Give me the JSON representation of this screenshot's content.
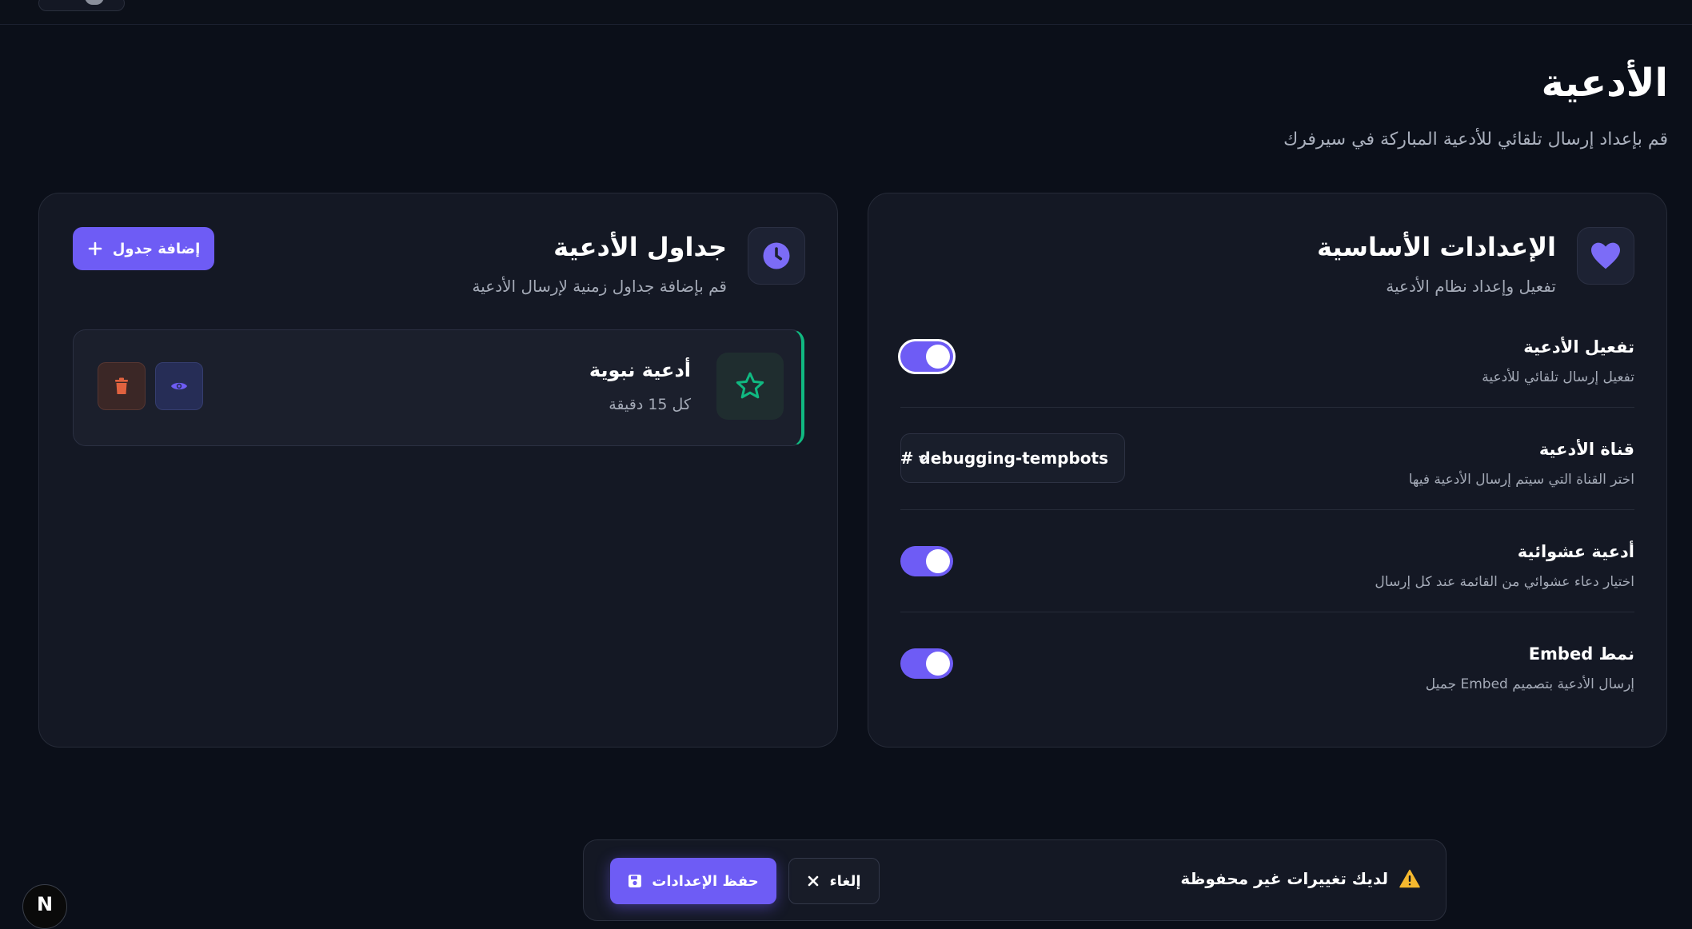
{
  "page": {
    "title": "الأدعية",
    "subtitle": "قم بإعداد إرسال تلقائي للأدعية المباركة في سيرفرك"
  },
  "settings_card": {
    "title": "الإعدادات الأساسية",
    "subtitle": "تفعيل وإعداد نظام الأدعية",
    "icon": "heart-icon",
    "rows": [
      {
        "label": "تفعيل الأدعية",
        "description": "تفعيل إرسال تلقائي للأدعية",
        "control": "toggle",
        "enabled": true
      },
      {
        "label": "قناة الأدعية",
        "description": "اختر القناة التي سيتم إرسال الأدعية فيها",
        "control": "select",
        "value": "# debugging-tempbots"
      },
      {
        "label": "أدعية عشوائية",
        "description": "اختيار دعاء عشوائي من القائمة عند كل إرسال",
        "control": "toggle",
        "enabled": true
      },
      {
        "label": "نمط Embed",
        "description": "إرسال الأدعية بتصميم Embed جميل",
        "control": "toggle",
        "enabled": true
      }
    ]
  },
  "schedules_card": {
    "title": "جداول الأدعية",
    "subtitle": "قم بإضافة جداول زمنية لإرسال الأدعية",
    "icon": "clock-icon",
    "add_button_label": "إضافة جدول",
    "schedules": [
      {
        "title": "أدعية نبوية",
        "interval": "كل 15 دقيقة",
        "icon": "star-icon"
      }
    ]
  },
  "save_bar": {
    "warning_text": "لديك تغييرات غير محفوظة",
    "cancel_label": "إلغاء",
    "save_label": "حفظ الإعدادات"
  },
  "badge": {
    "text": "N"
  },
  "colors": {
    "accent": "#6e5cf5",
    "success": "#10b981",
    "danger": "#e0623f",
    "warning": "#f5b82e",
    "background": "#0b0f19",
    "card": "#141824"
  }
}
